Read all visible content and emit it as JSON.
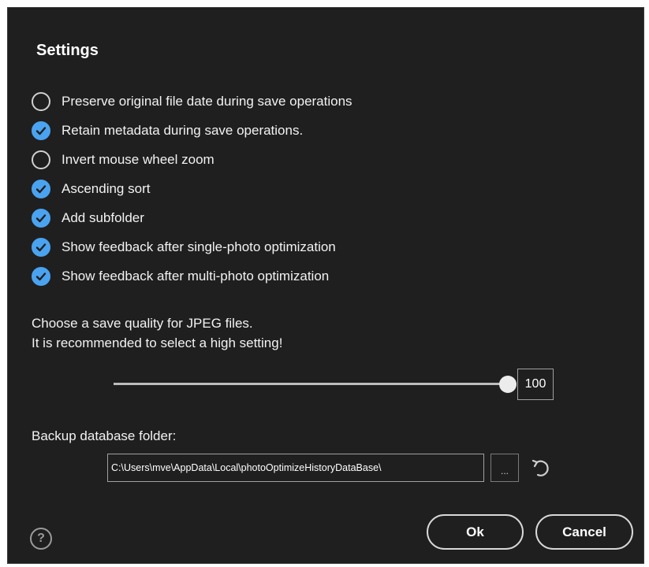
{
  "dialog": {
    "title": "Settings"
  },
  "options": [
    {
      "label": "Preserve original file date during save operations",
      "checked": false
    },
    {
      "label": "Retain metadata during save operations.",
      "checked": true
    },
    {
      "label": "Invert mouse wheel zoom",
      "checked": false
    },
    {
      "label": "Ascending sort",
      "checked": true
    },
    {
      "label": "Add subfolder",
      "checked": true
    },
    {
      "label": "Show feedback after single-photo optimization",
      "checked": true
    },
    {
      "label": "Show feedback after multi-photo optimization",
      "checked": true
    }
  ],
  "quality": {
    "line1": "Choose a save quality for JPEG files.",
    "line2": "It is recommended to select a high setting!",
    "value": "100",
    "level": 1.0
  },
  "backup": {
    "label": "Backup database folder:",
    "path": "C:\\Users\\mve\\AppData\\Local\\photoOptimizeHistoryDataBase\\",
    "browse_label": "..."
  },
  "footer": {
    "help_glyph": "?",
    "ok_label": "Ok",
    "cancel_label": "Cancel"
  },
  "icons": {
    "checked": "checkmark-circle-icon",
    "unchecked": "empty-circle-icon",
    "undo": "undo-icon",
    "help": "question-circle-icon"
  },
  "colors": {
    "background": "#1f1f1f",
    "accent": "#4aa3f0",
    "text": "#f2f2f2"
  }
}
